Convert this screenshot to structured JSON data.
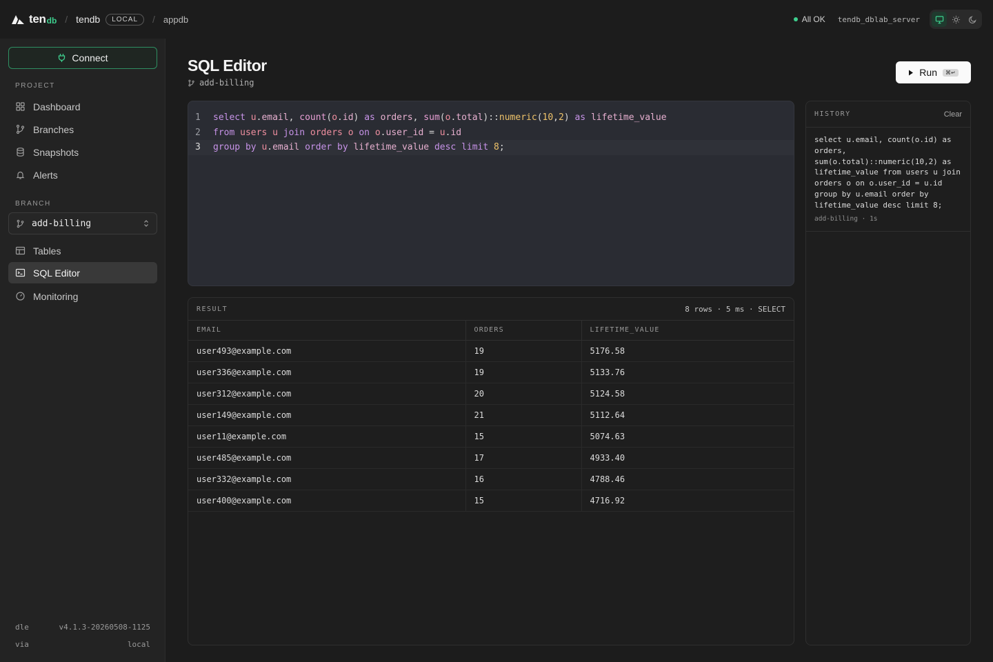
{
  "topbar": {
    "logo_ten": "ten",
    "logo_db": "db",
    "project": "tendb",
    "project_badge": "LOCAL",
    "database": "appdb",
    "status": "All OK",
    "server": "tendb_dblab_server",
    "theme_buttons": [
      "monitor-icon",
      "sun-icon",
      "moon-icon"
    ]
  },
  "sidebar": {
    "connect_label": "Connect",
    "project_section": "PROJECT",
    "project_items": [
      {
        "label": "Dashboard",
        "icon": "grid-icon"
      },
      {
        "label": "Branches",
        "icon": "branch-icon"
      },
      {
        "label": "Snapshots",
        "icon": "database-icon"
      },
      {
        "label": "Alerts",
        "icon": "bell-icon"
      }
    ],
    "branch_section": "BRANCH",
    "branch_selected": "add-billing",
    "branch_items": [
      {
        "label": "Tables",
        "icon": "table-icon"
      },
      {
        "label": "SQL Editor",
        "icon": "terminal-icon",
        "active": true
      },
      {
        "label": "Monitoring",
        "icon": "gauge-icon"
      }
    ],
    "footer": {
      "engine_label": "dle",
      "engine_version": "v4.1.3-20260508-1125",
      "via_label": "via",
      "via_value": "local"
    }
  },
  "main": {
    "title": "SQL Editor",
    "branch": "add-billing",
    "run_label": "Run",
    "run_shortcut": "⌘↵",
    "editor": {
      "line_numbers": [
        "1",
        "2",
        "3"
      ],
      "lines": [
        "select u.email, count(o.id) as orders, sum(o.total)::numeric(10,2) as lifetime_value",
        "from users u join orders o on o.user_id = u.id",
        "group by u.email order by lifetime_value desc limit 8;"
      ]
    },
    "result": {
      "label": "RESULT",
      "meta": "8 rows · 5 ms · SELECT",
      "columns": [
        "EMAIL",
        "ORDERS",
        "LIFETIME_VALUE"
      ],
      "rows": [
        [
          "user493@example.com",
          "19",
          "5176.58"
        ],
        [
          "user336@example.com",
          "19",
          "5133.76"
        ],
        [
          "user312@example.com",
          "20",
          "5124.58"
        ],
        [
          "user149@example.com",
          "21",
          "5112.64"
        ],
        [
          "user11@example.com",
          "15",
          "5074.63"
        ],
        [
          "user485@example.com",
          "17",
          "4933.40"
        ],
        [
          "user332@example.com",
          "16",
          "4788.46"
        ],
        [
          "user400@example.com",
          "15",
          "4716.92"
        ]
      ]
    },
    "history": {
      "label": "HISTORY",
      "clear_label": "Clear",
      "items": [
        {
          "sql": "select u.email, count(o.id) as orders, sum(o.total)::numeric(10,2) as lifetime_value from users u join orders o on o.user_id = u.id group by u.email order by lifetime_value desc limit 8;",
          "meta": "add-billing · 1s"
        }
      ]
    }
  },
  "colors": {
    "accent": "#3ecf8e",
    "background": "#1c1c1c",
    "sidebar": "#232323",
    "editor": "#2a2c33"
  }
}
